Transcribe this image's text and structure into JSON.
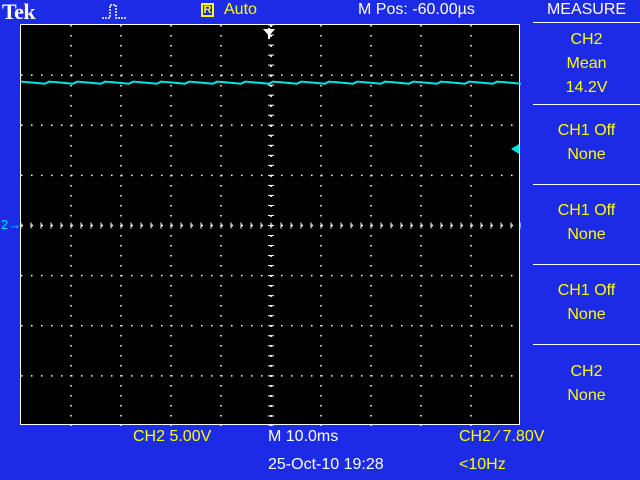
{
  "header": {
    "brand": "Tek",
    "acquisition_icon": "pulse-waveform-icon",
    "run_badge": "R",
    "run_mode": "Auto",
    "position": "M Pos: -60.00µs"
  },
  "measure": {
    "title": "MEASURE",
    "slots": [
      {
        "line1": "CH2",
        "line2": "Mean",
        "line3": "14.2V"
      },
      {
        "line1": "CH1 Off",
        "line2": "None"
      },
      {
        "line1": "CH1 Off",
        "line2": "None"
      },
      {
        "line1": "CH1 Off",
        "line2": "None"
      },
      {
        "line1": "CH2",
        "line2": "None"
      }
    ]
  },
  "status": {
    "ch2_scale": "CH2  5.00V",
    "timebase": "M 10.0ms",
    "trigger": "CH2 ∕ 7.80V",
    "datetime": "25-Oct-10 19:28",
    "frequency": "<10Hz"
  },
  "markers": {
    "ch2_ground": "2→"
  },
  "colors": {
    "frame": "#1c2ce6",
    "trace": "#00e5e5",
    "label": "#ffff00",
    "grid": "#ffffff",
    "screen": "#000000"
  },
  "trace": {
    "channel": "CH2",
    "mean_level_divisions": 2.85,
    "trigger_level_divisions": 1.56
  }
}
